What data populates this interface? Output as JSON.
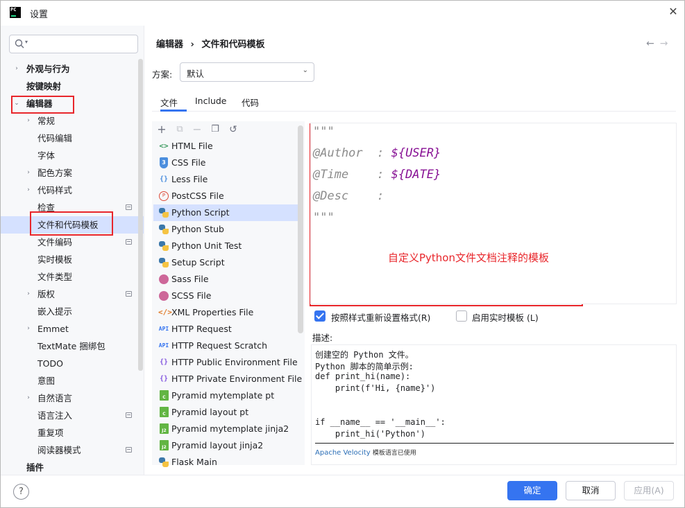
{
  "window": {
    "title": "设置",
    "logo_text": "PC"
  },
  "search": {
    "placeholder": ""
  },
  "sidebar": {
    "items": [
      {
        "label": "外观与行为",
        "chev": "›",
        "bold": true
      },
      {
        "label": "按键映射",
        "bold": true
      },
      {
        "label": "编辑器",
        "chev": "⌄",
        "bold": true
      },
      {
        "label": "常规",
        "chev": "›"
      },
      {
        "label": "代码编辑"
      },
      {
        "label": "字体"
      },
      {
        "label": "配色方案",
        "chev": "›"
      },
      {
        "label": "代码样式",
        "chev": "›"
      },
      {
        "label": "检查",
        "gear": true
      },
      {
        "label": "文件和代码模板",
        "selected": true
      },
      {
        "label": "文件编码",
        "gear": true
      },
      {
        "label": "实时模板"
      },
      {
        "label": "文件类型"
      },
      {
        "label": "版权",
        "chev": "›",
        "gear": true
      },
      {
        "label": "嵌入提示"
      },
      {
        "label": "Emmet",
        "chev": "›"
      },
      {
        "label": "TextMate 捆绑包"
      },
      {
        "label": "TODO"
      },
      {
        "label": "意图"
      },
      {
        "label": "自然语言",
        "chev": "›"
      },
      {
        "label": "语言注入",
        "gear": true
      },
      {
        "label": "重复项"
      },
      {
        "label": "阅读器模式",
        "gear": true
      },
      {
        "label": "插件",
        "bold": true
      }
    ]
  },
  "breadcrumb": {
    "parent": "编辑器",
    "separator": "›",
    "current": "文件和代码模板"
  },
  "nav": {
    "back": "←",
    "forward": "→"
  },
  "scheme": {
    "label": "方案:",
    "value": "默认"
  },
  "tabs": [
    {
      "label": "文件",
      "active": true
    },
    {
      "label": "Include"
    },
    {
      "label": "代码"
    }
  ],
  "file_toolbar": {
    "add": "+",
    "copy": "⧉",
    "remove": "−",
    "duplicate": "❐",
    "reset": "↺"
  },
  "files": [
    {
      "name": "HTML File",
      "icon": "html",
      "glyph": "<>"
    },
    {
      "name": "CSS File",
      "icon": "css",
      "glyph": "3"
    },
    {
      "name": "Less File",
      "icon": "less",
      "glyph": "{}"
    },
    {
      "name": "PostCSS File",
      "icon": "post",
      "glyph": "P"
    },
    {
      "name": "Python Script",
      "icon": "py",
      "selected": true
    },
    {
      "name": "Python Stub",
      "icon": "py"
    },
    {
      "name": "Python Unit Test",
      "icon": "py"
    },
    {
      "name": "Setup Script",
      "icon": "py"
    },
    {
      "name": "Sass File",
      "icon": "sass"
    },
    {
      "name": "SCSS File",
      "icon": "sass"
    },
    {
      "name": "XML Properties File",
      "icon": "xml",
      "glyph": "</>"
    },
    {
      "name": "HTTP Request",
      "icon": "api",
      "glyph": "API"
    },
    {
      "name": "HTTP Request Scratch",
      "icon": "api",
      "glyph": "API"
    },
    {
      "name": "HTTP Public Environment File",
      "icon": "env",
      "glyph": "{}"
    },
    {
      "name": "HTTP Private Environment File",
      "icon": "env",
      "glyph": "{}"
    },
    {
      "name": "Pyramid mytemplate pt",
      "icon": "pyr",
      "glyph": "C"
    },
    {
      "name": "Pyramid layout pt",
      "icon": "pyr",
      "glyph": "C"
    },
    {
      "name": "Pyramid mytemplate jinja2",
      "icon": "pyr",
      "glyph": "J2"
    },
    {
      "name": "Pyramid layout jinja2",
      "icon": "pyr",
      "glyph": "J2"
    },
    {
      "name": "Flask Main",
      "icon": "py"
    }
  ],
  "editor": {
    "lines": [
      {
        "text": "\"\"\""
      },
      {
        "text": "@Author  : ",
        "var": "${USER}"
      },
      {
        "text": "@Time    : ",
        "var": "${DATE}"
      },
      {
        "text": "@Desc    :"
      },
      {
        "text": "\"\"\""
      }
    ],
    "annotation": "自定义Python文件文档注释的模板"
  },
  "options": {
    "reformat": "按照样式重新设置格式(R)",
    "live_template": "启用实时模板 (L)"
  },
  "description": {
    "label": "描述:",
    "lines": [
      "创建空的 Python 文件。",
      "Python 脚本的简单示例:",
      "def print_hi(name):",
      "    print(f'Hi, {name}')",
      "",
      "",
      "if __name__ == '__main__':",
      "    print_hi('Python')"
    ],
    "footer_link": "Apache Velocity",
    "footer_text": "模板语言已使用"
  },
  "buttons": {
    "help": "?",
    "ok": "确定",
    "cancel": "取消",
    "apply": "应用(A)"
  },
  "colors": {
    "accent": "#3574f0",
    "annotation": "#e8262b",
    "selection": "#d5e1ff"
  }
}
